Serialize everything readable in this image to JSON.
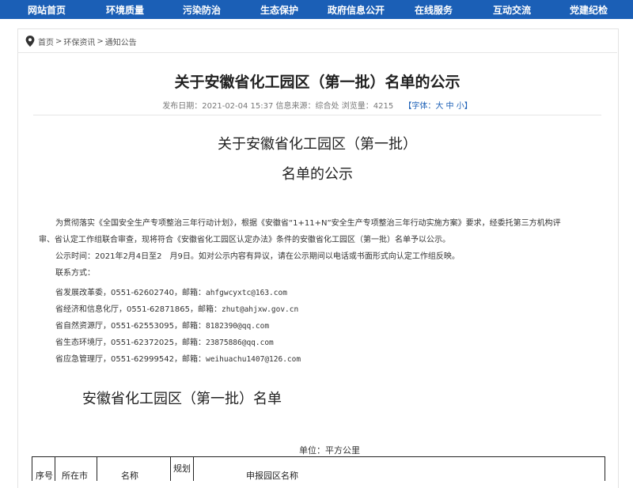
{
  "nav": {
    "items": [
      "网站首页",
      "环境质量",
      "污染防治",
      "生态保护",
      "政府信息公开",
      "在线服务",
      "互动交流",
      "党建纪检"
    ]
  },
  "breadcrumb": {
    "items": [
      "首页",
      "环保资讯",
      "通知公告"
    ],
    "separator": ">"
  },
  "article": {
    "title": "关于安徽省化工园区（第一批）名单的公示",
    "meta": "发布日期：2021-02-04 15:37   信息来源：综合处   浏览量：4215",
    "fontsize": "【字体：大 中 小】"
  },
  "doc": {
    "title_line1": "关于安徽省化工园区（第一批）",
    "title_line2": "名单的公示",
    "para1_line1": "为贯彻落实《全国安全生产专项整治三年行动计划》，根据《安徽省“1+11+N”安全生产专项整治三年行动实施方案》要求，经委托第三方机构评",
    "para1_line2": "审、省认定工作组联合审查，现将符合《安徽省化工园区认定办法》条件的安徽省化工园区（第一批）名单予以公示。",
    "para2": "公示时间：2021年2月4日至2　月9日。如对公示内容有异议，请在公示期间以电话或书面形式向认定工作组反映。",
    "contact_label": "联系方式：",
    "contacts": [
      {
        "org": "省发展改革委，0551-62602740，邮箱：",
        "email": "ahfgwcyxtc@163.com"
      },
      {
        "org": "省经济和信息化厅，0551-62871865，邮箱：",
        "email": "zhut@ahjxw.gov.cn"
      },
      {
        "org": "省自然资源厅，0551-62553095，邮箱：",
        "email": "8182390@qq.com"
      },
      {
        "org": "省生态环境厅，0551-62372025，邮箱：",
        "email": "23875886@qq.com"
      },
      {
        "org": "省应急管理厅，0551-62999542，邮箱：",
        "email": "weihuachu1407@126.com"
      }
    ],
    "list_title": "安徽省化工园区（第一批）名单",
    "unit": "单位：平方公里",
    "table_headers": [
      "序号",
      "所在市",
      "名称",
      "规划",
      "申报园区名称"
    ]
  }
}
